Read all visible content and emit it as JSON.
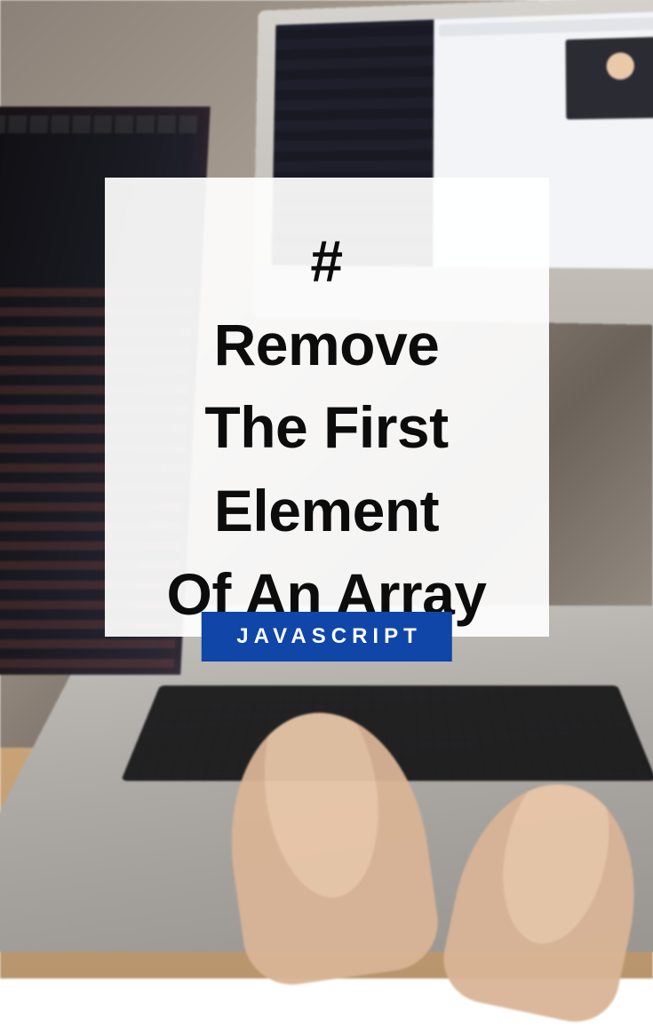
{
  "card": {
    "hash": "#",
    "line1": "Remove",
    "line2": "The First",
    "line3": "Element",
    "line4": "Of An Array"
  },
  "badge": {
    "label": "JAVASCRIPT"
  },
  "colors": {
    "badge_bg": "#0f46a7",
    "badge_text": "#ffffff",
    "title_text": "#0c0c0c"
  }
}
